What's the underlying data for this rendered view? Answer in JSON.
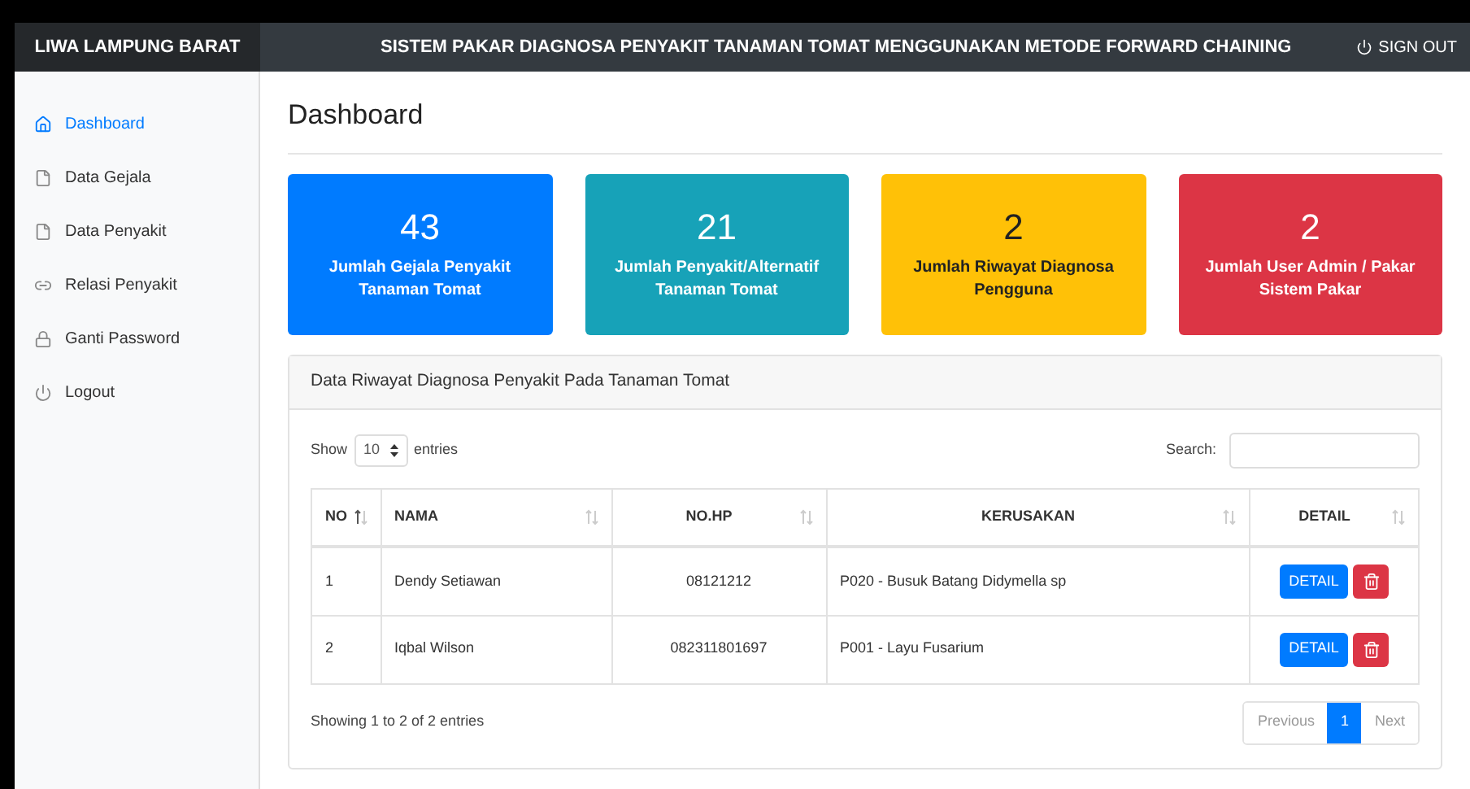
{
  "brand": "LIWA LAMPUNG BARAT",
  "header": {
    "title": "SISTEM PAKAR DIAGNOSA PENYAKIT TANAMAN TOMAT MENGGUNAKAN METODE FORWARD CHAINING",
    "signout": "SIGN OUT"
  },
  "sidebar": {
    "items": [
      {
        "label": "Dashboard",
        "kind": "home",
        "selected": true
      },
      {
        "label": "Data Gejala",
        "kind": "file",
        "selected": false
      },
      {
        "label": "Data Penyakit",
        "kind": "file",
        "selected": false
      },
      {
        "label": "Relasi Penyakit",
        "kind": "link",
        "selected": false
      },
      {
        "label": "Ganti Password",
        "kind": "lock",
        "selected": false
      },
      {
        "label": "Logout",
        "kind": "power",
        "selected": false
      }
    ]
  },
  "page_title": "Dashboard",
  "stats": [
    {
      "value": "43",
      "label": "Jumlah Gejala Penyakit Tanaman Tomat",
      "color": "#007bff"
    },
    {
      "value": "21",
      "label": "Jumlah Penyakit/Alternatif Tanaman Tomat",
      "color": "#17a2b8"
    },
    {
      "value": "2",
      "label": "Jumlah Riwayat Diagnosa Pengguna",
      "color": "#ffc107"
    },
    {
      "value": "2",
      "label": "Jumlah User Admin / Pakar Sistem Pakar",
      "color": "#dc3545"
    }
  ],
  "panel": {
    "title": "Data Riwayat Diagnosa Penyakit Pada Tanaman Tomat",
    "show_label": "Show",
    "page_size": "10",
    "entries_label": "entries",
    "search_label": "Search:",
    "table": {
      "columns": [
        {
          "label": "NO",
          "sorted": true
        },
        {
          "label": "NAMA",
          "sorted": false
        },
        {
          "label": "NO.HP",
          "sorted": false
        },
        {
          "label": "KERUSAKAN",
          "sorted": false
        },
        {
          "label": "DETAIL",
          "sorted": false
        }
      ],
      "rows": [
        {
          "no": "1",
          "nama": "Dendy Setiawan",
          "hp": "08121212",
          "kerusakan": "P020 - Busuk Batang Didymella sp",
          "detail": "DETAIL"
        },
        {
          "no": "2",
          "nama": "Iqbal Wilson",
          "hp": "082311801697",
          "kerusakan": "P001 - Layu Fusarium",
          "detail": "DETAIL"
        }
      ]
    },
    "info": "Showing 1 to 2 of 2 entries",
    "pagination": [
      {
        "label": "Previous",
        "selected": false,
        "disabled": true
      },
      {
        "label": "1",
        "selected": true,
        "disabled": false
      },
      {
        "label": "Next",
        "selected": false,
        "disabled": true
      }
    ]
  }
}
